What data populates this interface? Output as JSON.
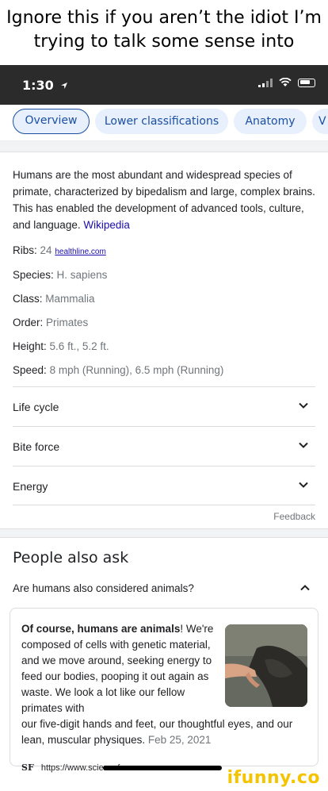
{
  "meme": {
    "caption_line1": "Ignore this if you aren’t the idiot I’m",
    "caption_line2": "trying to talk some sense into"
  },
  "status_bar": {
    "time": "1:30",
    "location_icon": "location-arrow-icon",
    "signal_icon": "signal-icon",
    "wifi_icon": "wifi-icon",
    "battery_icon": "battery-icon"
  },
  "tabs": [
    {
      "label": "Overview",
      "active": true
    },
    {
      "label": "Lower classifications",
      "active": false
    },
    {
      "label": "Anatomy",
      "active": false
    },
    {
      "label": "V",
      "active": false
    }
  ],
  "description": {
    "text": "Humans are the most abundant and widespread species of primate, characterized by bipedalism and large, complex brains. This has enabled the development of advanced tools, culture, and language.",
    "source": "Wikipedia"
  },
  "facts": [
    {
      "label": "Ribs:",
      "value": "24",
      "source": "healthline.com"
    },
    {
      "label": "Species:",
      "value": "H. sapiens"
    },
    {
      "label": "Class:",
      "value": "Mammalia"
    },
    {
      "label": "Order:",
      "value": "Primates"
    },
    {
      "label": "Height:",
      "value": "5.6 ft., 5.2 ft."
    },
    {
      "label": "Speed:",
      "value": "8 mph (Running), 6.5 mph (Running)"
    }
  ],
  "expanders": [
    {
      "label": "Life cycle"
    },
    {
      "label": "Bite force"
    },
    {
      "label": "Energy"
    }
  ],
  "feedback": "Feedback",
  "paa": {
    "title": "People also ask",
    "question": "Are humans also considered animals?",
    "answer_bold": "Of course, humans are animals",
    "answer_rest": "! We're composed of cells with genetic material, and we move around, seeking energy to feed our bodies, pooping it out again as waste. We look a lot like our fellow primates with",
    "answer_more": "our five-digit hands and feet, our thoughtful eyes, and our lean, muscular physiques.",
    "date": "Feb 25, 2021",
    "source_logo": "SF",
    "source_url": "https://www.sciencefocus.com › are-..."
  },
  "watermark": "ifunny.co",
  "colors": {
    "link": "#1a0dab",
    "tab_bg": "#e8f0fe",
    "tab_text": "#1a4fa3",
    "muted": "#70757a"
  }
}
